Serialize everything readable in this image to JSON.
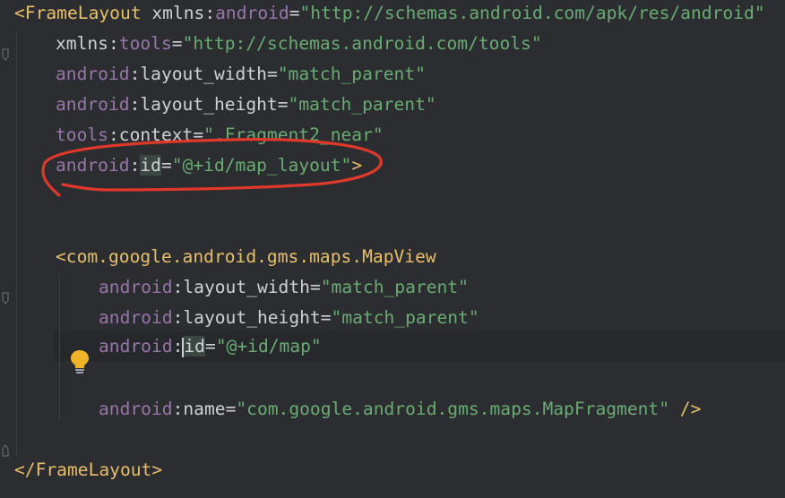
{
  "lines": [
    {
      "tag_open": "<FrameLayout",
      "ns": "xmlns",
      "colon": ":",
      "attr": "android",
      "eq": "=",
      "val": "\"http://schemas.android.com/apk/res/android\""
    },
    {
      "ns": "xmlns",
      "colon": ":",
      "attr": "tools",
      "eq": "=",
      "val": "\"http://schemas.android.com/tools\""
    },
    {
      "ns": "android",
      "colon": ":",
      "attr": "layout_width",
      "eq": "=",
      "val": "\"match_parent\""
    },
    {
      "ns": "android",
      "colon": ":",
      "attr": "layout_height",
      "eq": "=",
      "val": "\"match_parent\""
    },
    {
      "ns": "tools",
      "colon": ":",
      "attr": "context",
      "eq": "=",
      "val": "\".Fragment2_near\""
    },
    {
      "ns": "android",
      "colon": ":",
      "attr": "id",
      "eq": "=",
      "val": "\"@+id/map_layout\"",
      "close": ">"
    },
    {
      "tag_open": "<com.google.android.gms.maps.MapView"
    },
    {
      "ns": "android",
      "colon": ":",
      "attr": "layout_width",
      "eq": "=",
      "val": "\"match_parent\""
    },
    {
      "ns": "android",
      "colon": ":",
      "attr": "layout_height",
      "eq": "=",
      "val": "\"match_parent\""
    },
    {
      "ns": "android",
      "colon": ":",
      "attr": "id",
      "eq": "=",
      "val": "\"@+id/map\""
    },
    {
      "ns": "android",
      "colon": ":",
      "attr": "name",
      "eq": "=",
      "val": "\"com.google.android.gms.maps.MapFragment\"",
      "close": " />"
    },
    {
      "tag_close": "</FrameLayout>"
    }
  ],
  "colors": {
    "background": "#2b2d30",
    "tag": "#e8bf6a",
    "namespace": "#9876aa",
    "value": "#6aab73",
    "annotation": "#e0392b"
  },
  "icons": {
    "intention": "lightbulb-icon"
  }
}
